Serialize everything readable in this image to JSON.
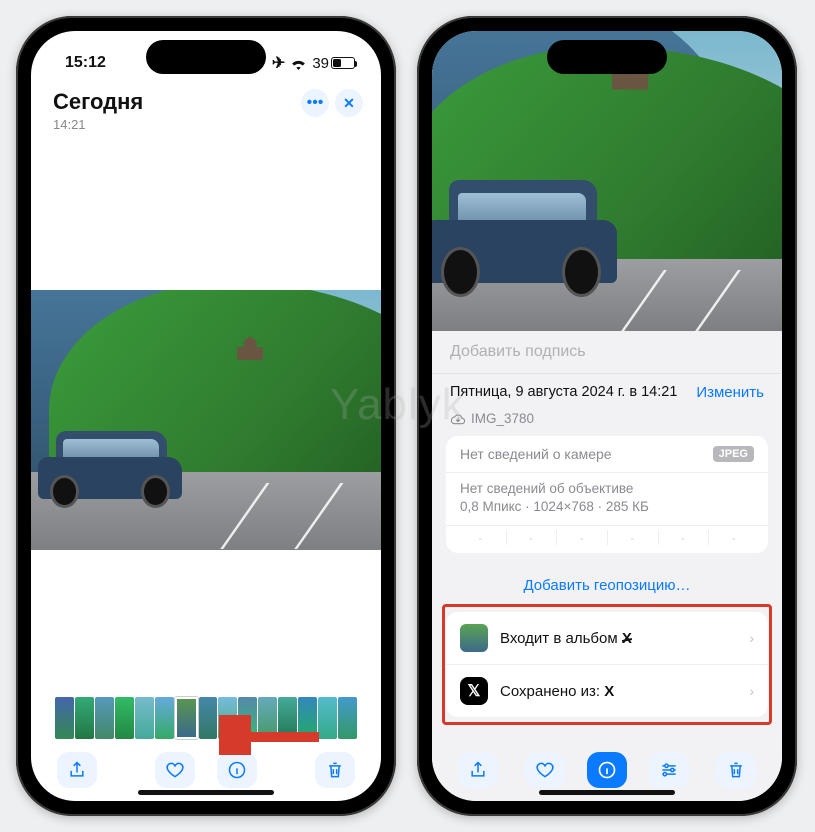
{
  "status": {
    "time": "15:12",
    "battery": "39"
  },
  "left": {
    "title": "Сегодня",
    "subtitle": "14:21"
  },
  "right": {
    "caption_placeholder": "Добавить подпись",
    "date": "Пятница, 9 августа 2024 г. в 14:21",
    "edit": "Изменить",
    "filename": "IMG_3780",
    "camera_none": "Нет сведений о камере",
    "jpeg": "JPEG",
    "lens_none": "Нет сведений об объективе",
    "specs": "0,8 Мпикс  ·  1024×768  ·  285 КБ",
    "geo": "Добавить геопозицию…",
    "album_prefix": "Входит в альбом ",
    "album_x": "X",
    "saved_prefix": "Сохранено из: ",
    "saved_x": "X"
  },
  "watermark": "Yablyk"
}
